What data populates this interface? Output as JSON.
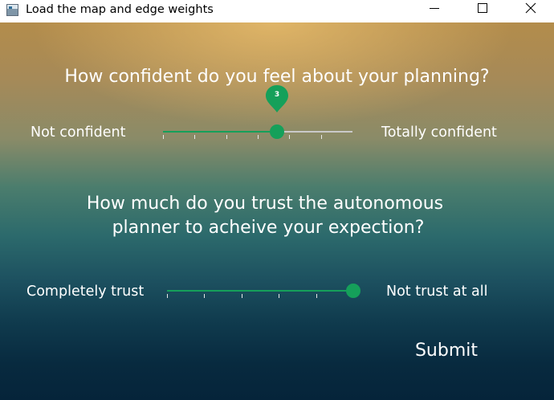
{
  "window": {
    "title": "Load the map and edge weights",
    "icon": "application-window-icon",
    "controls": [
      "minimize-icon",
      "maximize-icon",
      "close-icon"
    ]
  },
  "survey": {
    "confidence": {
      "question": "How confident do you feel about your planning?",
      "min_label": "Not confident",
      "max_label": "Totally confident",
      "value": 3,
      "value_label": "3",
      "min": 0,
      "max": 5,
      "tick_count": 6
    },
    "trust": {
      "question_line1": "How much do you trust the autonomous",
      "question_line2": "planner to acheive your expection?",
      "min_label": "Completely trust",
      "max_label": "Not trust at all",
      "value": 5,
      "min": 0,
      "max": 5,
      "tick_count": 5
    },
    "submit_label": "Submit"
  },
  "colors": {
    "accent": "#15a05a",
    "track": "#c9c9c9",
    "text": "#ffffff",
    "background_top": "#b38c4b",
    "background_bottom": "#05243a"
  }
}
